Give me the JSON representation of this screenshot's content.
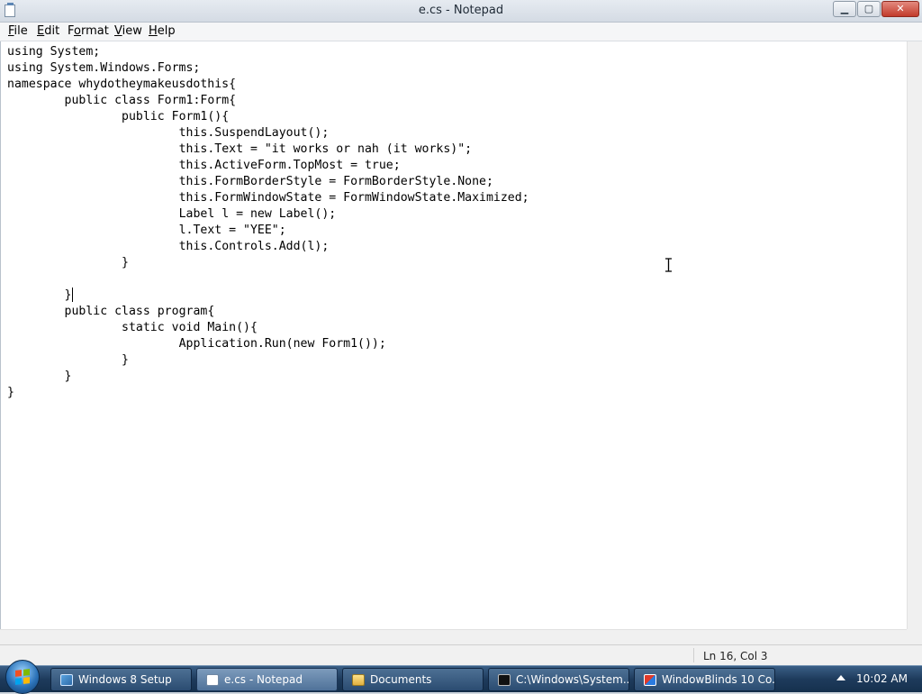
{
  "window": {
    "title": "e.cs - Notepad",
    "buttons": {
      "minimize": "▁",
      "maximize": "▢",
      "close": "✕"
    }
  },
  "menu": {
    "items": [
      {
        "accel": "F",
        "rest": "ile"
      },
      {
        "accel": "E",
        "rest": "dit"
      },
      {
        "accel": "",
        "rest": "Format",
        "accel_index": "o"
      },
      {
        "accel": "V",
        "rest": "iew"
      },
      {
        "accel": "H",
        "rest": "elp"
      }
    ]
  },
  "editor": {
    "content": "using System;\nusing System.Windows.Forms;\nnamespace whydotheymakeusdothis{\n\tpublic class Form1:Form{\n\t\tpublic Form1(){\n\t\t\tthis.SuspendLayout();\n\t\t\tthis.Text = \"it works or nah (it works)\";\n\t\t\tthis.ActiveForm.TopMost = true;\n\t\t\tthis.FormBorderStyle = FormBorderStyle.None;\n\t\t\tthis.FormWindowState = FormWindowState.Maximized;\n\t\t\tLabel l = new Label();\n\t\t\tl.Text = \"YEE\";\n\t\t\tthis.Controls.Add(l);\n\t\t}\n\n\t}\n\tpublic class program{\n\t\tstatic void Main(){\n\t\t\tApplication.Run(new Form1());\n\t\t}\n\t}\n}"
  },
  "status": {
    "position": "Ln 16, Col 3"
  },
  "taskbar": {
    "tasks": [
      {
        "label": "Windows 8 Setup",
        "icon": "setup-icon"
      },
      {
        "label": "e.cs - Notepad",
        "icon": "notepad-icon"
      },
      {
        "label": "Documents",
        "icon": "folder-icon"
      },
      {
        "label": "C:\\Windows\\System...",
        "icon": "cmd-icon"
      },
      {
        "label": "WindowBlinds 10 Co...",
        "icon": "windowblinds-icon"
      }
    ],
    "clock": "10:02 AM"
  }
}
